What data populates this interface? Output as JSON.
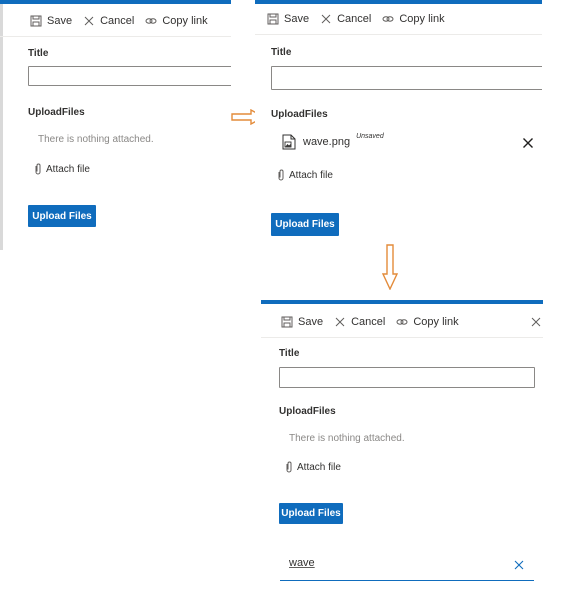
{
  "toolbar": {
    "save_label": "Save",
    "cancel_label": "Cancel",
    "copy_link_label": "Copy link"
  },
  "form": {
    "title_label": "Title",
    "upload_label": "UploadFiles",
    "empty_message": "There is nothing attached.",
    "attach_label": "Attach file",
    "upload_button": "Upload Files"
  },
  "attachment": {
    "filename": "wave.png",
    "status": "Unsaved"
  },
  "search": {
    "value": "wave"
  },
  "colors": {
    "accent": "#0f6cbd",
    "arrow": "#e38b3a"
  }
}
